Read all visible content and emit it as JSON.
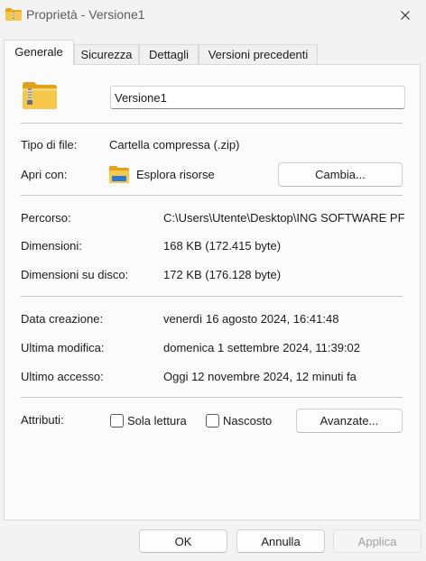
{
  "window": {
    "title": "Proprietà - Versione1",
    "title_icon": "zip-folder-icon",
    "close_icon": "close-icon"
  },
  "tabs": [
    {
      "label": "Generale",
      "active": true
    },
    {
      "label": "Sicurezza",
      "active": false
    },
    {
      "label": "Dettagli",
      "active": false
    },
    {
      "label": "Versioni precedenti",
      "active": false
    }
  ],
  "general": {
    "file_icon": "zip-folder-icon",
    "name_value": "Versione1",
    "type_label": "Tipo di file:",
    "type_value": "Cartella compressa (.zip)",
    "open_with_label": "Apri con:",
    "open_with_icon": "file-explorer-icon",
    "open_with_value": "Esplora risorse",
    "change_button": "Cambia...",
    "path_label": "Percorso:",
    "path_value": "C:\\Users\\Utente\\Desktop\\ING SOFTWARE PF",
    "size_label": "Dimensioni:",
    "size_value": "168 KB (172.415 byte)",
    "disk_size_label": "Dimensioni su disco:",
    "disk_size_value": "172 KB (176.128 byte)",
    "created_label": "Data creazione:",
    "created_value": "venerdì 16 agosto 2024, 16:41:48",
    "modified_label": "Ultima modifica:",
    "modified_value": "domenica 1 settembre 2024, 11:39:02",
    "accessed_label": "Ultimo accesso:",
    "accessed_value": "Oggi 12 novembre 2024, 12 minuti fa",
    "attributes_label": "Attributi:",
    "readonly_label": "Sola lettura",
    "readonly_checked": false,
    "hidden_label": "Nascosto",
    "hidden_checked": false,
    "advanced_button": "Avanzate..."
  },
  "footer": {
    "ok": "OK",
    "cancel": "Annulla",
    "apply": "Applica"
  },
  "colors": {
    "folder_yellow": "#f5c84c",
    "background": "#f3f3f3",
    "panel": "#fbfbfb"
  }
}
